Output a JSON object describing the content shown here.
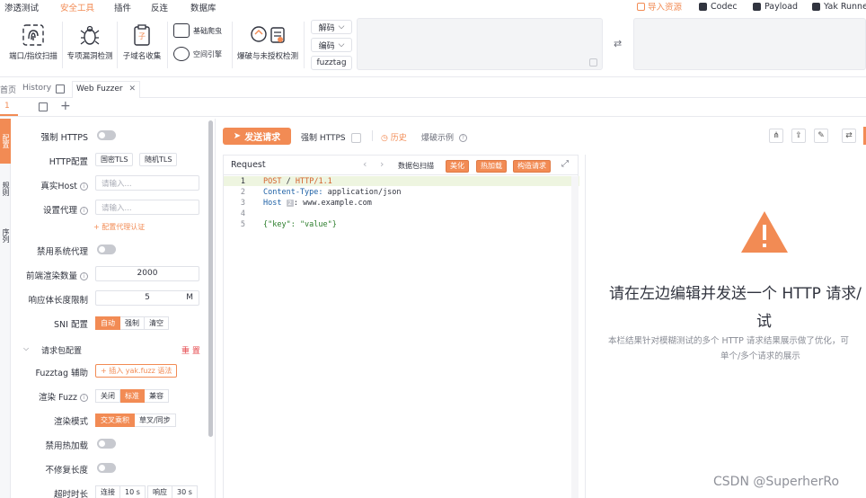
{
  "menu": {
    "items": [
      "渗透测试",
      "安全工具",
      "插件",
      "反连",
      "数据库"
    ],
    "active": "安全工具",
    "import_resource": "导入资源",
    "right_buttons": [
      "Codec",
      "Payload",
      "Yak Runner"
    ]
  },
  "toolbar": {
    "port_scan": "端口/指纹扫描",
    "vuln_detect": "专项漏洞检测",
    "subdomain": "子域名收集",
    "crawler": "基础爬虫",
    "space_engine": "空间引擎",
    "brute": "爆破与未授权检测",
    "decode": "解码",
    "encode": "编码",
    "fuzztag": "fuzztag"
  },
  "tabs": {
    "home": "首页",
    "history": "History",
    "web_fuzzer": "Web Fuzzer",
    "sub_tab_number": "1"
  },
  "rail": {
    "config": "配置",
    "rules": "规则",
    "sequence": "序列"
  },
  "config": {
    "force_https": "强制 HTTPS",
    "http_config": "HTTP配置",
    "gm_tls": "国密TLS",
    "random_tls": "随机TLS",
    "real_host": "真实Host",
    "real_host_placeholder": "请输入...",
    "proxy": "设置代理",
    "proxy_placeholder": "请输入...",
    "proxy_auth": "+ 配置代理认证",
    "disable_sys_proxy": "禁用系统代理",
    "render_count": "前端渲染数量",
    "render_count_value": "2000",
    "resp_limit": "响应体长度限制",
    "resp_limit_value": "5",
    "resp_limit_unit": "M",
    "sni": "SNI 配置",
    "sni_options": [
      "自动",
      "强制",
      "清空"
    ],
    "sni_selected": "自动",
    "packet_config": "请求包配置",
    "reset": "重 置",
    "fuzztag_helper": "Fuzztag 辅助",
    "insert_fuzz": "+ 插入 yak.fuzz 语法",
    "render_fuzz": "渲染 Fuzz",
    "render_fuzz_options": [
      "关闭",
      "标准",
      "兼容"
    ],
    "render_fuzz_selected": "标准",
    "render_mode": "渲染模式",
    "render_mode_options": [
      "交叉乘积",
      "草叉/同步"
    ],
    "render_mode_selected": "交叉乘积",
    "disable_hotpatch": "禁用热加载",
    "no_fix_length": "不修复长度",
    "timeout": "超时时长",
    "connect": "连接",
    "connect_value": "10 s",
    "response": "响应",
    "response_value": "30 s"
  },
  "main": {
    "send_button": "发送请求",
    "force_https": "强制 HTTPS",
    "history": "历史",
    "burst_example": "爆破示例",
    "request_label": "Request",
    "packet_scan": "数据包扫描",
    "beautify": "美化",
    "hot_load": "热加载",
    "build_request": "构造请求"
  },
  "editor": {
    "line_numbers": [
      "1",
      "2",
      "3",
      "4",
      "5"
    ],
    "method": "POST",
    "path": "/",
    "version": "HTTP/1.1",
    "ct_key": "Content-Type:",
    "ct_value": "application/json",
    "host_key": "Host",
    "host_badge": "2",
    "host_value": "www.example.com",
    "body": "{\"key\": \"value\"}"
  },
  "response": {
    "title_line1": "请在左边编辑并发送一个 HTTP 请求/",
    "title_line2": "试",
    "sub_line1": "本栏结果针对模糊测试的多个 HTTP 请求结果展示做了优化，可",
    "sub_line2": "单个/多个请求的展示",
    "warning_color": "#f28b54"
  },
  "watermark": "CSDN @SuperherRo"
}
